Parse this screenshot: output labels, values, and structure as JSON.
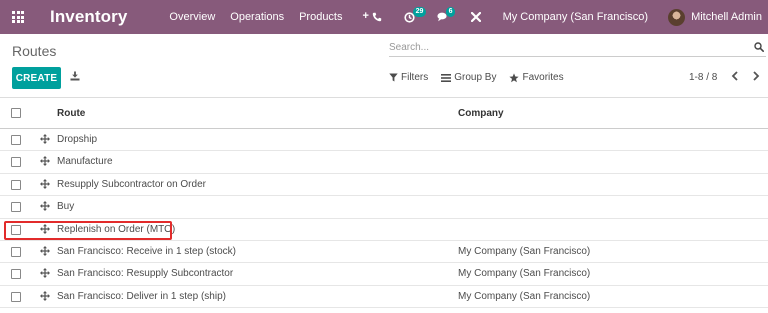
{
  "navbar": {
    "brand": "Inventory",
    "menu": [
      "Overview",
      "Operations",
      "Products"
    ],
    "activity_count": "29",
    "message_count": "6",
    "company": "My Company (San Francisco)",
    "user": "Mitchell Admin"
  },
  "page": {
    "title": "Routes",
    "search_placeholder": "Search...",
    "create_label": "CREATE",
    "filters_label": "Filters",
    "groupby_label": "Group By",
    "favorites_label": "Favorites",
    "pager": "1-8 / 8"
  },
  "table": {
    "headers": {
      "route": "Route",
      "company": "Company"
    },
    "rows": [
      {
        "route": "Dropship",
        "company": ""
      },
      {
        "route": "Manufacture",
        "company": ""
      },
      {
        "route": "Resupply Subcontractor on Order",
        "company": ""
      },
      {
        "route": "Buy",
        "company": ""
      },
      {
        "route": "Replenish on Order (MTO)",
        "company": ""
      },
      {
        "route": "San Francisco: Receive in 1 step (stock)",
        "company": "My Company (San Francisco)"
      },
      {
        "route": "San Francisco: Resupply Subcontractor",
        "company": "My Company (San Francisco)"
      },
      {
        "route": "San Francisco: Deliver in 1 step (ship)",
        "company": "My Company (San Francisco)"
      }
    ]
  },
  "colors": {
    "navbar": "#875a7b",
    "primary_button": "#00a09d",
    "highlight": "#e22b2b"
  },
  "icons": [
    "apps-icon",
    "phone-icon",
    "activity-icon",
    "chat-icon",
    "close-icon",
    "search-icon",
    "download-icon",
    "filter-icon",
    "groupby-icon",
    "star-icon",
    "chevron-left-icon",
    "chevron-right-icon",
    "drag-handle-icon"
  ]
}
